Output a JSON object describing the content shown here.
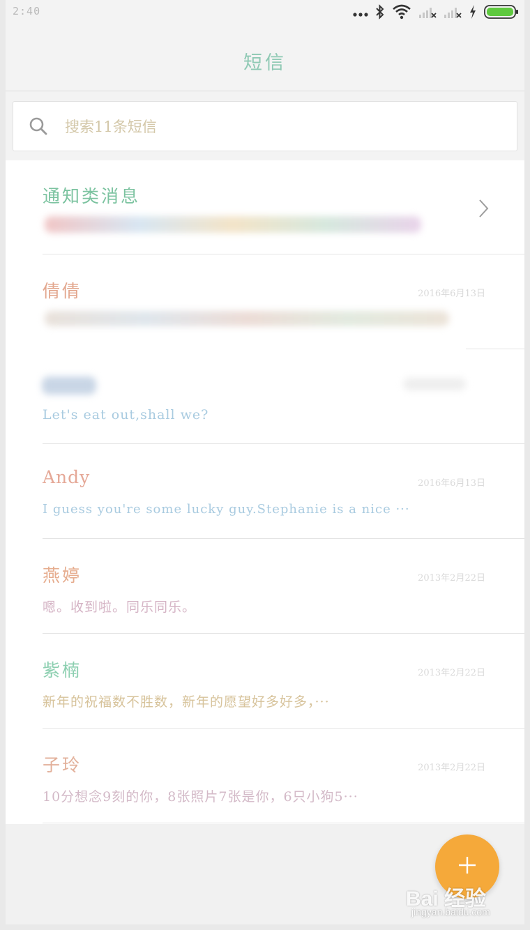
{
  "status_bar": {
    "time": "2:40",
    "icons": [
      "more-dots-icon",
      "bluetooth-icon",
      "wifi-icon",
      "signal-no-service-icon",
      "signal-no-service-icon",
      "charging-icon",
      "battery-icon"
    ],
    "battery_color": "#5fc93f"
  },
  "header": {
    "title": "短信"
  },
  "search": {
    "placeholder": "搜索11条短信"
  },
  "conversations": [
    {
      "name": "通知类消息",
      "date": "",
      "preview": "",
      "name_color": "#7cc3a0",
      "preview_color": "#b9b9b9"
    },
    {
      "name": "倩倩",
      "date": "2016年6月13日",
      "preview": "",
      "name_color": "#e3a78e",
      "preview_color": "#c0c0c0"
    },
    {
      "name": "",
      "date": "",
      "preview": "Let's eat out,shall we?",
      "name_color": "#b0c4d8",
      "preview_color": "#a9cbe0"
    },
    {
      "name": "Andy",
      "date": "2016年6月13日",
      "preview": "I guess you're some lucky guy.Stephanie is a nice ···",
      "name_color": "#e5a897",
      "preview_color": "#a9cbe0"
    },
    {
      "name": "燕婷",
      "date": "2013年2月22日",
      "preview": "嗯。收到啦。同乐同乐。",
      "name_color": "#e6ad8f",
      "preview_color": "#d5b4c5"
    },
    {
      "name": "紫楠",
      "date": "2013年2月22日",
      "preview": "新年的祝福数不胜数，新年的愿望好多好多，···",
      "name_color": "#8ccfb0",
      "preview_color": "#d7c39b"
    },
    {
      "name": "子玲",
      "date": "2013年2月22日",
      "preview": "10分想念9刻的你，8张照片7张是你，6只小狗5···",
      "name_color": "#e2b09a",
      "preview_color": "#d3b9c7"
    }
  ],
  "fab": {
    "icon": "plus-icon",
    "color": "#f5a93a"
  },
  "watermark": {
    "brand": "Bai 经验",
    "url": "jingyan.baidu.com"
  }
}
